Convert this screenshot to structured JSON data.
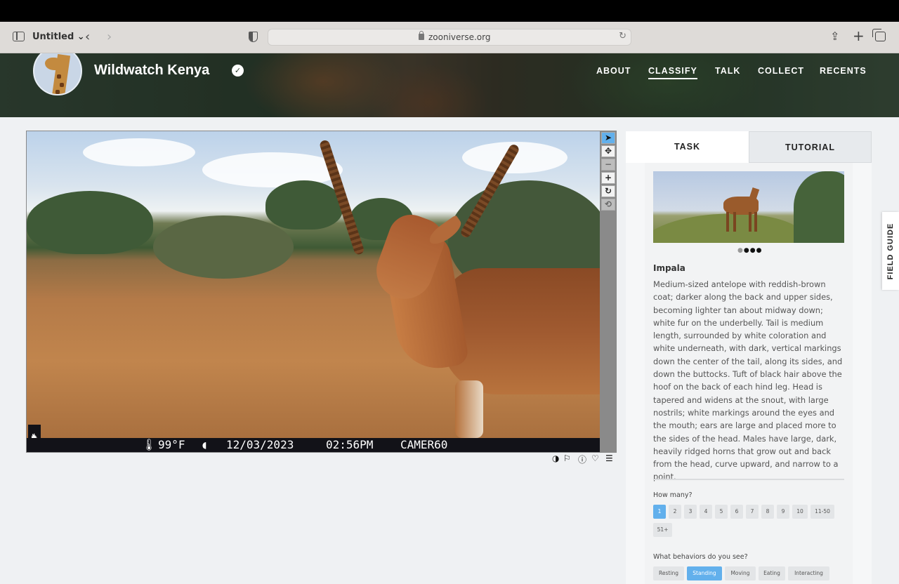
{
  "browser": {
    "tab_title": "Untitled ⌄",
    "url": "zooniverse.org",
    "icons": [
      "sidebar-toggle-icon",
      "back-icon",
      "forward-icon",
      "shield-icon",
      "lock-icon",
      "reload-icon",
      "share-icon",
      "new-tab-icon",
      "tab-overview-icon"
    ]
  },
  "site": {
    "title": "Wildwatch Kenya",
    "nav": [
      {
        "label": "ABOUT",
        "active": false
      },
      {
        "label": "CLASSIFY",
        "active": true
      },
      {
        "label": "TALK",
        "active": false
      },
      {
        "label": "COLLECT",
        "active": false
      },
      {
        "label": "RECENTS",
        "active": false
      }
    ]
  },
  "camera_info": {
    "temperature": "99°F",
    "date": "12/03/2023",
    "time": "02:56PM",
    "camera": "CAMER60"
  },
  "viewer_tools": [
    "pointer-icon",
    "move-icon",
    "zoom-out-icon",
    "zoom-in-icon",
    "rotate-icon",
    "reset-icon"
  ],
  "image_actions": [
    "invert-icon",
    "flag-icon",
    "info-icon",
    "favorite-icon",
    "collections-icon"
  ],
  "panel": {
    "tabs": [
      "TASK",
      "TUTORIAL"
    ],
    "active_tab": "TASK",
    "species": {
      "name": "Impala",
      "description": "Medium-sized antelope with reddish-brown coat; darker along the back and upper sides, becoming lighter tan about midway down; white fur on the underbelly. Tail is medium length, surrounded by white coloration and white underneath, with dark, vertical markings down the center of the tail, along its sides, and down the buttocks. Tuft of black hair above the hoof on the back of each hind leg. Head is tapered and widens at the snout, with large nostrils; white markings around the eyes and the mouth; ears are large and placed more to the sides of the head. Males have large, dark, heavily ridged horns that grow out and back from the head, curve upward, and narrow to a point.",
      "carousel_total": 4,
      "carousel_active": 1
    },
    "how_many": {
      "label": "How many?",
      "options": [
        "1",
        "2",
        "3",
        "4",
        "5",
        "6",
        "7",
        "8",
        "9",
        "10",
        "11-50",
        "51+"
      ],
      "selected": "1"
    },
    "behaviors": {
      "label": "What behaviors do you see?",
      "options": [
        "Resting",
        "Standing",
        "Moving",
        "Eating",
        "Interacting"
      ],
      "selected": [
        "Standing"
      ]
    }
  },
  "field_guide": {
    "label": "FIELD GUIDE"
  },
  "colors": {
    "accent": "#62b0ec",
    "header_text": "#ffffff"
  }
}
